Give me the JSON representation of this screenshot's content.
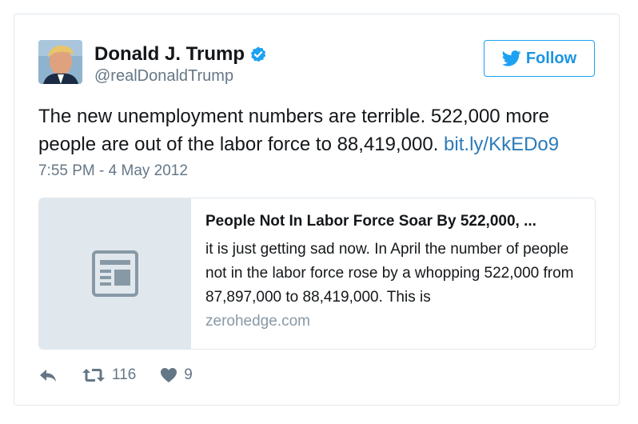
{
  "tweet": {
    "author": {
      "display_name": "Donald J. Trump",
      "screen_name": "@realDonaldTrump",
      "verified_icon": "verified-badge-icon"
    },
    "follow_label": "Follow",
    "text": "The new unemployment numbers are terrible. 522,000 more people are out of the labor force to 88,419,000. ",
    "link_text": "bit.ly/KkEDo9",
    "timestamp": "7:55 PM - 4 May 2012",
    "card": {
      "thumbnail_icon": "article-icon",
      "title": "People Not In Labor Force Soar By 522,000, ...",
      "description": "it is just getting sad now. In April the number of people not in the labor force rose by a whopping 522,000 from 87,897,000 to 88,419,000.  This is",
      "domain": "zerohedge.com"
    },
    "actions": {
      "reply_icon": "reply-icon",
      "retweet_icon": "retweet-icon",
      "retweet_count": "116",
      "like_icon": "heart-icon",
      "like_count": "9"
    }
  },
  "colors": {
    "brand_blue": "#1da1f2",
    "link_blue": "#2b7bb9",
    "muted_text": "#657786",
    "border": "#e1e8ed"
  }
}
